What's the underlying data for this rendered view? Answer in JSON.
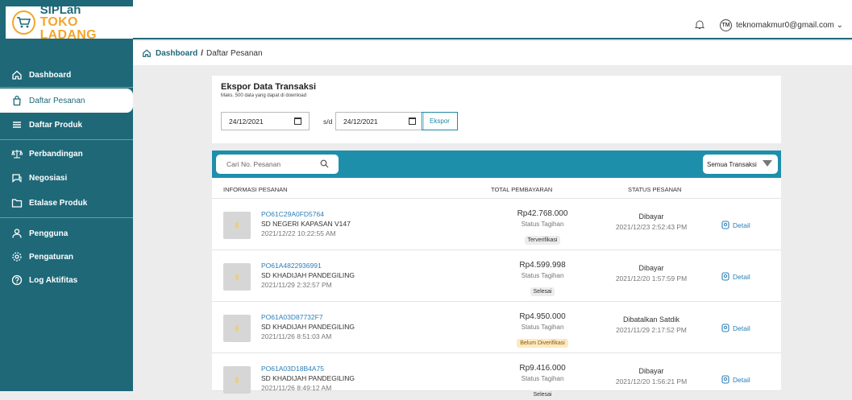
{
  "brand": {
    "line1": "SIPLah",
    "line2": "TOKO LADANG",
    "accent": "#f4a62a",
    "primary": "#1e6878"
  },
  "sidebar": {
    "items": [
      {
        "label": "Dashboard",
        "icon": "home-icon"
      },
      {
        "label": "Daftar Pesanan",
        "icon": "bag-icon",
        "active": true
      },
      {
        "label": "Daftar Produk",
        "icon": "list-icon"
      },
      {
        "label": "Perbandingan",
        "icon": "scale-icon"
      },
      {
        "label": "Negosiasi",
        "icon": "chat-icon"
      },
      {
        "label": "Etalase Produk",
        "icon": "folder-icon"
      },
      {
        "label": "Pengguna",
        "icon": "user-icon"
      },
      {
        "label": "Pengaturan",
        "icon": "gear-icon"
      },
      {
        "label": "Log Aktifitas",
        "icon": "help-icon"
      }
    ]
  },
  "topbar": {
    "email": "teknomakmur0@gmail.com",
    "avatar_text": "TM"
  },
  "breadcrumb": {
    "home": "Dashboard",
    "separator": "/",
    "current": "Daftar Pesanan"
  },
  "export": {
    "title": "Ekspor Data Transaksi",
    "subtitle": "Maks. 500 data yang dapat di download",
    "date_from": "24/12/2021",
    "separator": "s/d",
    "date_to": "24/12/2021",
    "button": "Ekspor"
  },
  "table": {
    "search_placeholder": "Cari No. Pesanan",
    "filter_label": "Semua Transaksi",
    "headers": {
      "info": "INFORMASI PESANAN",
      "total": "TOTAL PEMBAYARAN",
      "status": "STATUS PESANAN"
    },
    "rows": [
      {
        "po": "PO61C29A0FD5764",
        "school": "SD NEGERI KAPASAN V147",
        "date": "2021/12/22 10:22:55 AM",
        "amount": "Rp42.768.000",
        "tag": "Status Tagihan",
        "badge": "Terverifikasi",
        "status": "Dibayar",
        "status_date": "2021/12/23 2:52:43 PM",
        "action": "Detail"
      },
      {
        "po": "PO61A4822936991",
        "school": "SD KHADIJAH PANDEGILING",
        "date": "2021/11/29 2:32:57 PM",
        "amount": "Rp4.599.998",
        "tag": "Status Tagihan",
        "badge": "Selesai",
        "status": "Dibayar",
        "status_date": "2021/12/20 1:57:59 PM",
        "action": "Detail"
      },
      {
        "po": "PO61A03D87732F7",
        "school": "SD KHADIJAH PANDEGILING",
        "date": "2021/11/26 8:51:03 AM",
        "amount": "Rp4.950.000",
        "tag": "Status Tagihan",
        "badge": "Belum Diverifikasi",
        "status": "Dibatalkan Satdik",
        "status_date": "2021/11/29 2:17:52 PM",
        "action": "Detail"
      },
      {
        "po": "PO61A03D18B4A75",
        "school": "SD KHADIJAH PANDEGILING",
        "date": "2021/11/26 8:49:12 AM",
        "amount": "Rp9.416.000",
        "tag": "Status Tagihan",
        "badge": "Selesai",
        "status": "Dibayar",
        "status_date": "2021/12/20 1:56:21 PM",
        "action": "Detail"
      }
    ]
  }
}
